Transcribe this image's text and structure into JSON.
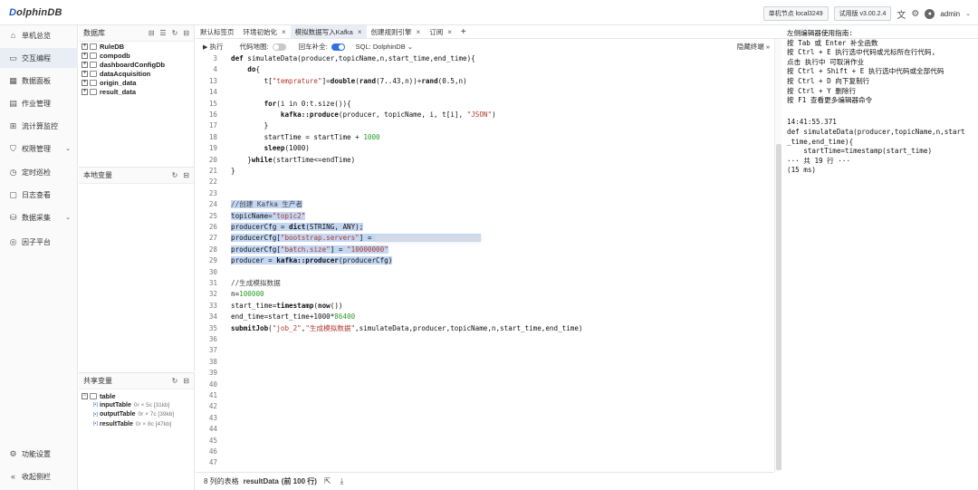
{
  "app": {
    "logo_a": "D",
    "logo_b": "olphinDB"
  },
  "topbar": {
    "node": "单机节点 local3249",
    "version": "试用版 v3.00.2.4",
    "user": "admin"
  },
  "nav": [
    {
      "label": "单机总览",
      "icon": "home-icon"
    },
    {
      "label": "交互编程",
      "icon": "code-icon"
    },
    {
      "label": "数据面板",
      "icon": "dashboard-icon"
    },
    {
      "label": "作业管理",
      "icon": "job-icon"
    },
    {
      "label": "流计算监控",
      "icon": "stream-icon"
    },
    {
      "label": "权限管理",
      "icon": "shield-icon"
    },
    {
      "label": "定时巡检",
      "icon": "clock-icon"
    },
    {
      "label": "日志查看",
      "icon": "log-icon"
    },
    {
      "label": "数据采集",
      "icon": "collect-icon"
    },
    {
      "label": "因子平台",
      "icon": "factor-icon"
    }
  ],
  "nav_bottom": {
    "settings": "功能设置",
    "collapse": "收起侧栏"
  },
  "db_panel": {
    "title": "数据库",
    "items": [
      "RuleDB",
      "compodb",
      "dashboardConfigDb",
      "dataAcquisition",
      "origin_data",
      "result_data"
    ]
  },
  "local_vars": {
    "title": "本地变量"
  },
  "shared_vars": {
    "title": "共享变量",
    "group": "table",
    "items": [
      {
        "name": "inputTable",
        "meta": "0r × 5c [31kb]"
      },
      {
        "name": "outputTable",
        "meta": "0r × 7c [39kb]"
      },
      {
        "name": "resultTable",
        "meta": "0r × 8c [47kb]"
      }
    ]
  },
  "tabs": [
    {
      "label": "默认标签页",
      "close": false
    },
    {
      "label": "环境初始化",
      "close": true
    },
    {
      "label": "模拟数据写入Kafka",
      "close": true
    },
    {
      "label": "创建规则引擎",
      "close": true
    },
    {
      "label": "订阅",
      "close": true
    }
  ],
  "toolbar": {
    "run": "执行",
    "minimap": "代码地图:",
    "enter_complete": "回车补全:",
    "sql": "SQL: DolphinDB",
    "hide_terminal": "隐藏终端"
  },
  "code_lines": [
    {
      "n": "3",
      "t": "def simulateData(producer,topicName,n,start_time,end_time){"
    },
    {
      "n": "4",
      "t": "    do{"
    },
    {
      "n": "13",
      "t": "        t[\"temprature\"]=double(rand(7..43,n))+rand(0.5,n)"
    },
    {
      "n": "14",
      "t": ""
    },
    {
      "n": "15",
      "t": "        for(i in 0:t.size()){"
    },
    {
      "n": "16",
      "t": "            kafka::produce(producer, topicName, i, t[i], \"JSON\")"
    },
    {
      "n": "17",
      "t": "        }"
    },
    {
      "n": "18",
      "t": "        startTime = startTime + 1000"
    },
    {
      "n": "19",
      "t": "        sleep(1000)"
    },
    {
      "n": "20",
      "t": "    }while(startTime<=endTime)"
    },
    {
      "n": "21",
      "t": "}"
    },
    {
      "n": "22",
      "t": ""
    },
    {
      "n": "23",
      "t": ""
    },
    {
      "n": "24",
      "t": "//创建 Kafka 生产者"
    },
    {
      "n": "25",
      "t": "topicName=\"topic2\""
    },
    {
      "n": "26",
      "t": "producerCfg = dict(STRING, ANY);"
    },
    {
      "n": "27",
      "t": "producerCfg[\"bootstrap.servers\"] = "
    },
    {
      "n": "28",
      "t": "producerCfg[\"batch.size\"] = \"10000000\""
    },
    {
      "n": "29",
      "t": "producer = kafka::producer(producerCfg)"
    },
    {
      "n": "30",
      "t": ""
    },
    {
      "n": "31",
      "t": "//生成模拟数据"
    },
    {
      "n": "32",
      "t": "n=100000"
    },
    {
      "n": "33",
      "t": "start_time=timestamp(now())"
    },
    {
      "n": "34",
      "t": "end_time=start_time+1000*86400"
    },
    {
      "n": "35",
      "t": "submitJob(\"job_2\",\"生成模拟数据\",simulateData,producer,topicName,n,start_time,end_time)"
    },
    {
      "n": "36",
      "t": ""
    },
    {
      "n": "37",
      "t": ""
    },
    {
      "n": "38",
      "t": ""
    },
    {
      "n": "39",
      "t": ""
    },
    {
      "n": "40",
      "t": ""
    },
    {
      "n": "41",
      "t": ""
    },
    {
      "n": "42",
      "t": ""
    },
    {
      "n": "43",
      "t": ""
    },
    {
      "n": "44",
      "t": ""
    },
    {
      "n": "45",
      "t": ""
    },
    {
      "n": "46",
      "t": ""
    },
    {
      "n": "47",
      "t": ""
    }
  ],
  "help_lines": [
    "左侧编辑器使用指南:",
    "按 Tab 或 Enter 补全函数",
    "按 Ctrl + E 执行选中代码或光标所在行代码,",
    "点击 执行中 可取消作业",
    "按 Ctrl + Shift + E 执行选中代码或全部代码",
    "按 Ctrl + D 向下复制行",
    "按 Ctrl + Y 删除行",
    "按 F1 查看更多编辑器命令",
    "",
    "14:41:55.371",
    "def simulateData(producer,topicName,n,start",
    "_time,end_time){",
    "    startTime=timestamp(start_time)",
    "··· 共 19 行 ···",
    "(15 ms)"
  ],
  "bottom": {
    "prefix": "8 列的表格",
    "name": "resultData",
    "rows": "(前 100 行)"
  }
}
